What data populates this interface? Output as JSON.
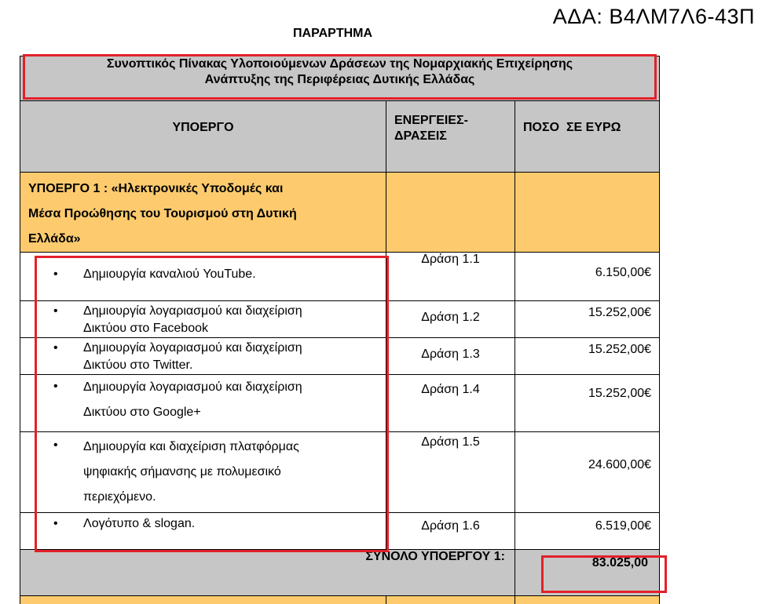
{
  "ada": "ΑΔΑ: Β4ΛΜ7Λ6-43Π",
  "heading": "ΠΑΡΑΡΤΗΜΑ",
  "table": {
    "title_line1": "Συνοπτικός Πίνακας Υλοποιούμενων Δράσεων της Νομαρχιακής Επιχείρησης",
    "title_line2": "Ανάπτυξης της Περιφέρειας Δυτικής Ελλάδας",
    "col_subproject": "ΥΠΟΕΡΓΟ",
    "col_actions_1": "ΕΝΕΡΓΕΙΕΣ-",
    "col_actions_2": "ΔΡΑΣΕΙΣ",
    "col_amount": "ΠΟΣΟ  ΣΕ ΕΥΡΩ",
    "subproject_line1": "ΥΠΟΕΡΓΟ 1  : «Ηλεκτρονικές Υποδομές και",
    "subproject_line2": "Μέσα Προώθησης του Τουρισμού στη Δυτική",
    "subproject_line3": "Ελλάδα»",
    "bullet": "•",
    "items": [
      {
        "line1": "Δημιουργία καναλιού YouTube.",
        "line2": "",
        "line3": "",
        "action": "Δράση 1.1",
        "amount": "6.150,00€"
      },
      {
        "line1": "Δημιουργία λογαριασμού και διαχείριση",
        "line2": "Δικτύου στο Facebook",
        "line3": "",
        "action": "Δράση 1.2",
        "amount": "15.252,00€"
      },
      {
        "line1": "Δημιουργία λογαριασμού και διαχείριση",
        "line2": "Δικτύου στο Twitter.",
        "line3": "",
        "action": "Δράση 1.3",
        "amount": "15.252,00€"
      },
      {
        "line1": "Δημιουργία λογαριασμού και διαχείριση",
        "line2": "Δικτύου στο Google+",
        "line3": "",
        "action": "Δράση 1.4",
        "amount": "15.252,00€"
      },
      {
        "line1": "Δημιουργία και διαχείριση πλατφόρμας",
        "line2": "ψηφιακής σήμανσης με πολυμεσικό",
        "line3": "περιεχόμενο.",
        "action": "Δράση 1.5",
        "amount": "24.600,00€"
      },
      {
        "line1": "Λογότυπο & slogan.",
        "line2": "",
        "line3": "",
        "action": "Δράση 1.6",
        "amount": "6.519,00€"
      }
    ],
    "total_label": "ΣΥΝΟΛΟ ΥΠΟΕΡΓΟΥ 1:",
    "total_value": "83.025,00"
  },
  "colors": {
    "header_gray": "#c6c6c6",
    "subproject_orange": "#fdcb6e",
    "highlight_red": "#e3202a"
  }
}
